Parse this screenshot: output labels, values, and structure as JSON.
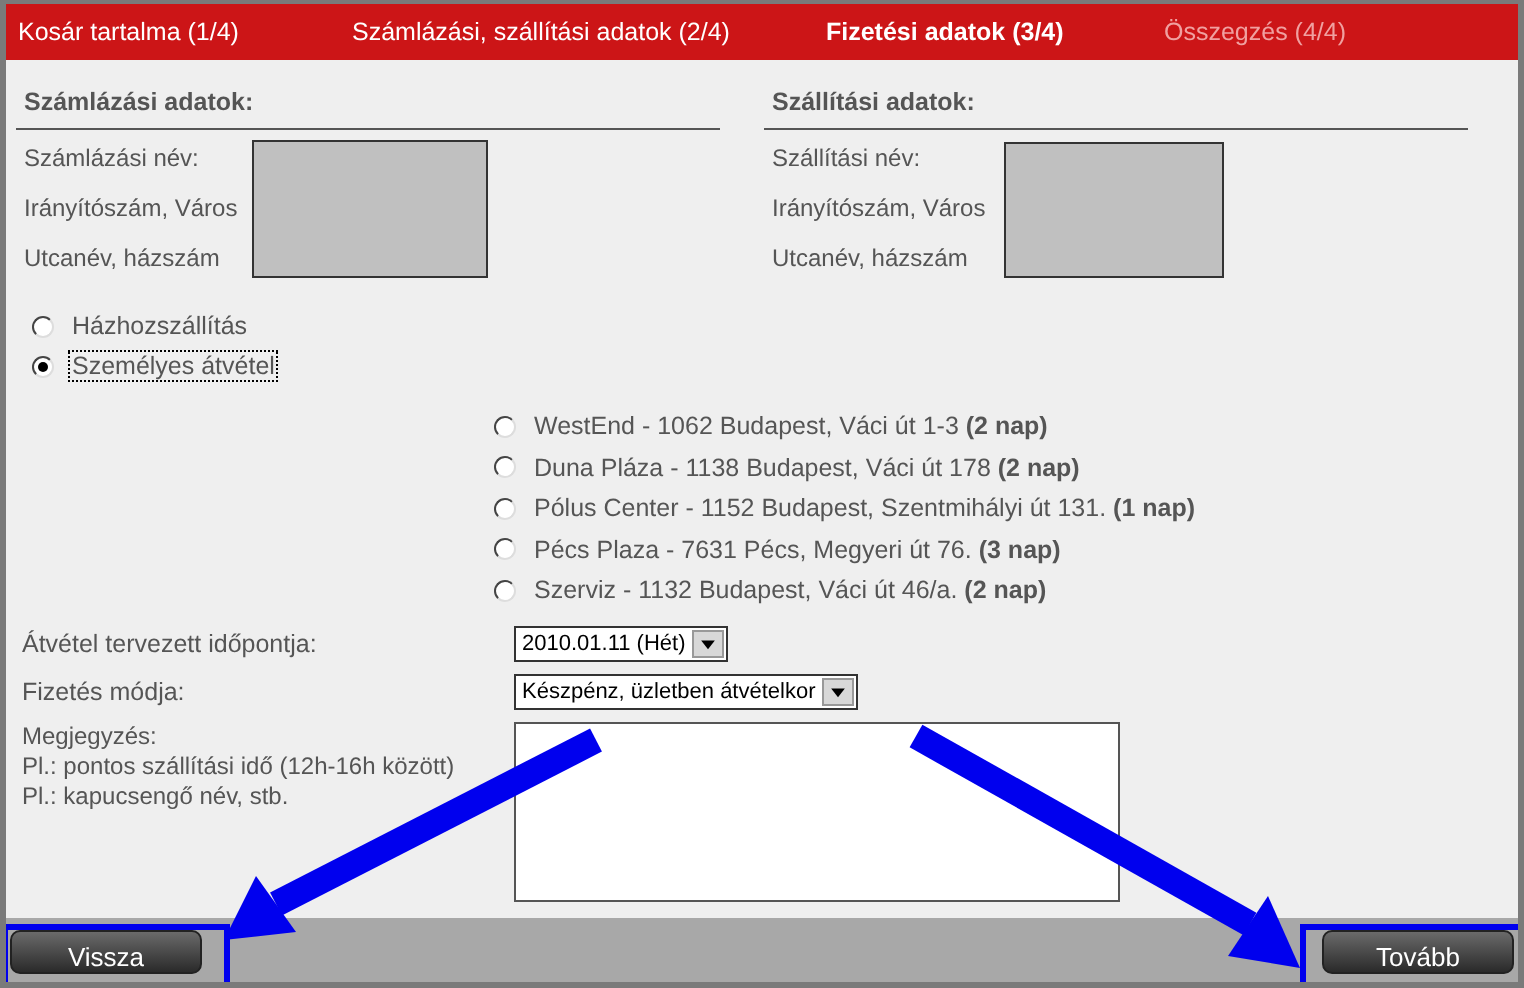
{
  "steps": [
    {
      "label": "Kosár tartalma (1/4)",
      "selected": false,
      "disabled": false
    },
    {
      "label": "Számlázási, szállítási adatok (2/4)",
      "selected": false,
      "disabled": false
    },
    {
      "label": "Fizetési adatok (3/4)",
      "selected": true,
      "disabled": false
    },
    {
      "label": "Összegzés (4/4)",
      "selected": false,
      "disabled": true
    }
  ],
  "billing": {
    "title": "Számlázási adatok:",
    "labels": [
      "Számlázási név:",
      "Irányítószám, Város",
      "Utcanév, házszám"
    ]
  },
  "shipping": {
    "title": "Szállítási adatok:",
    "labels": [
      "Szállítási név:",
      "Irányítószám, Város",
      "Utcanév, házszám"
    ]
  },
  "delivery_options": [
    {
      "label": "Házhozszállítás",
      "selected": false
    },
    {
      "label": "Személyes átvétel",
      "selected": true
    }
  ],
  "stores": [
    {
      "label": "WestEnd - 1062 Budapest, Váci út 1-3 **(2 nap)**",
      "selected": false
    },
    {
      "label": "Duna Pláza - 1138 Budapest, Váci út 178 **(2 nap)**",
      "selected": false
    },
    {
      "label": "Pólus Center - 1152 Budapest, Szentmihályi út 131. **(1 nap)**",
      "selected": false
    },
    {
      "label": "Pécs Plaza - 7631 Pécs, Megyeri út 76. **(3 nap)**",
      "selected": false
    },
    {
      "label": "Szerviz - 1132 Budapest, Váci út 46/a. **(2 nap)**",
      "selected": false
    }
  ],
  "pickup_date": {
    "label": "Átvétel tervezett időpontja:",
    "value": "2010.01.11 (Hét)"
  },
  "payment": {
    "label": "Fizetés módja:",
    "value": "Készpénz, üzletben átvételkor"
  },
  "note": {
    "label_lines": [
      "Megjegyzés:",
      "Pl.: pontos szállítási idő (12h-16h között)",
      "Pl.: kapucsengő név, stb."
    ]
  },
  "buttons": {
    "back": "Vissza",
    "next": "Tovább"
  }
}
